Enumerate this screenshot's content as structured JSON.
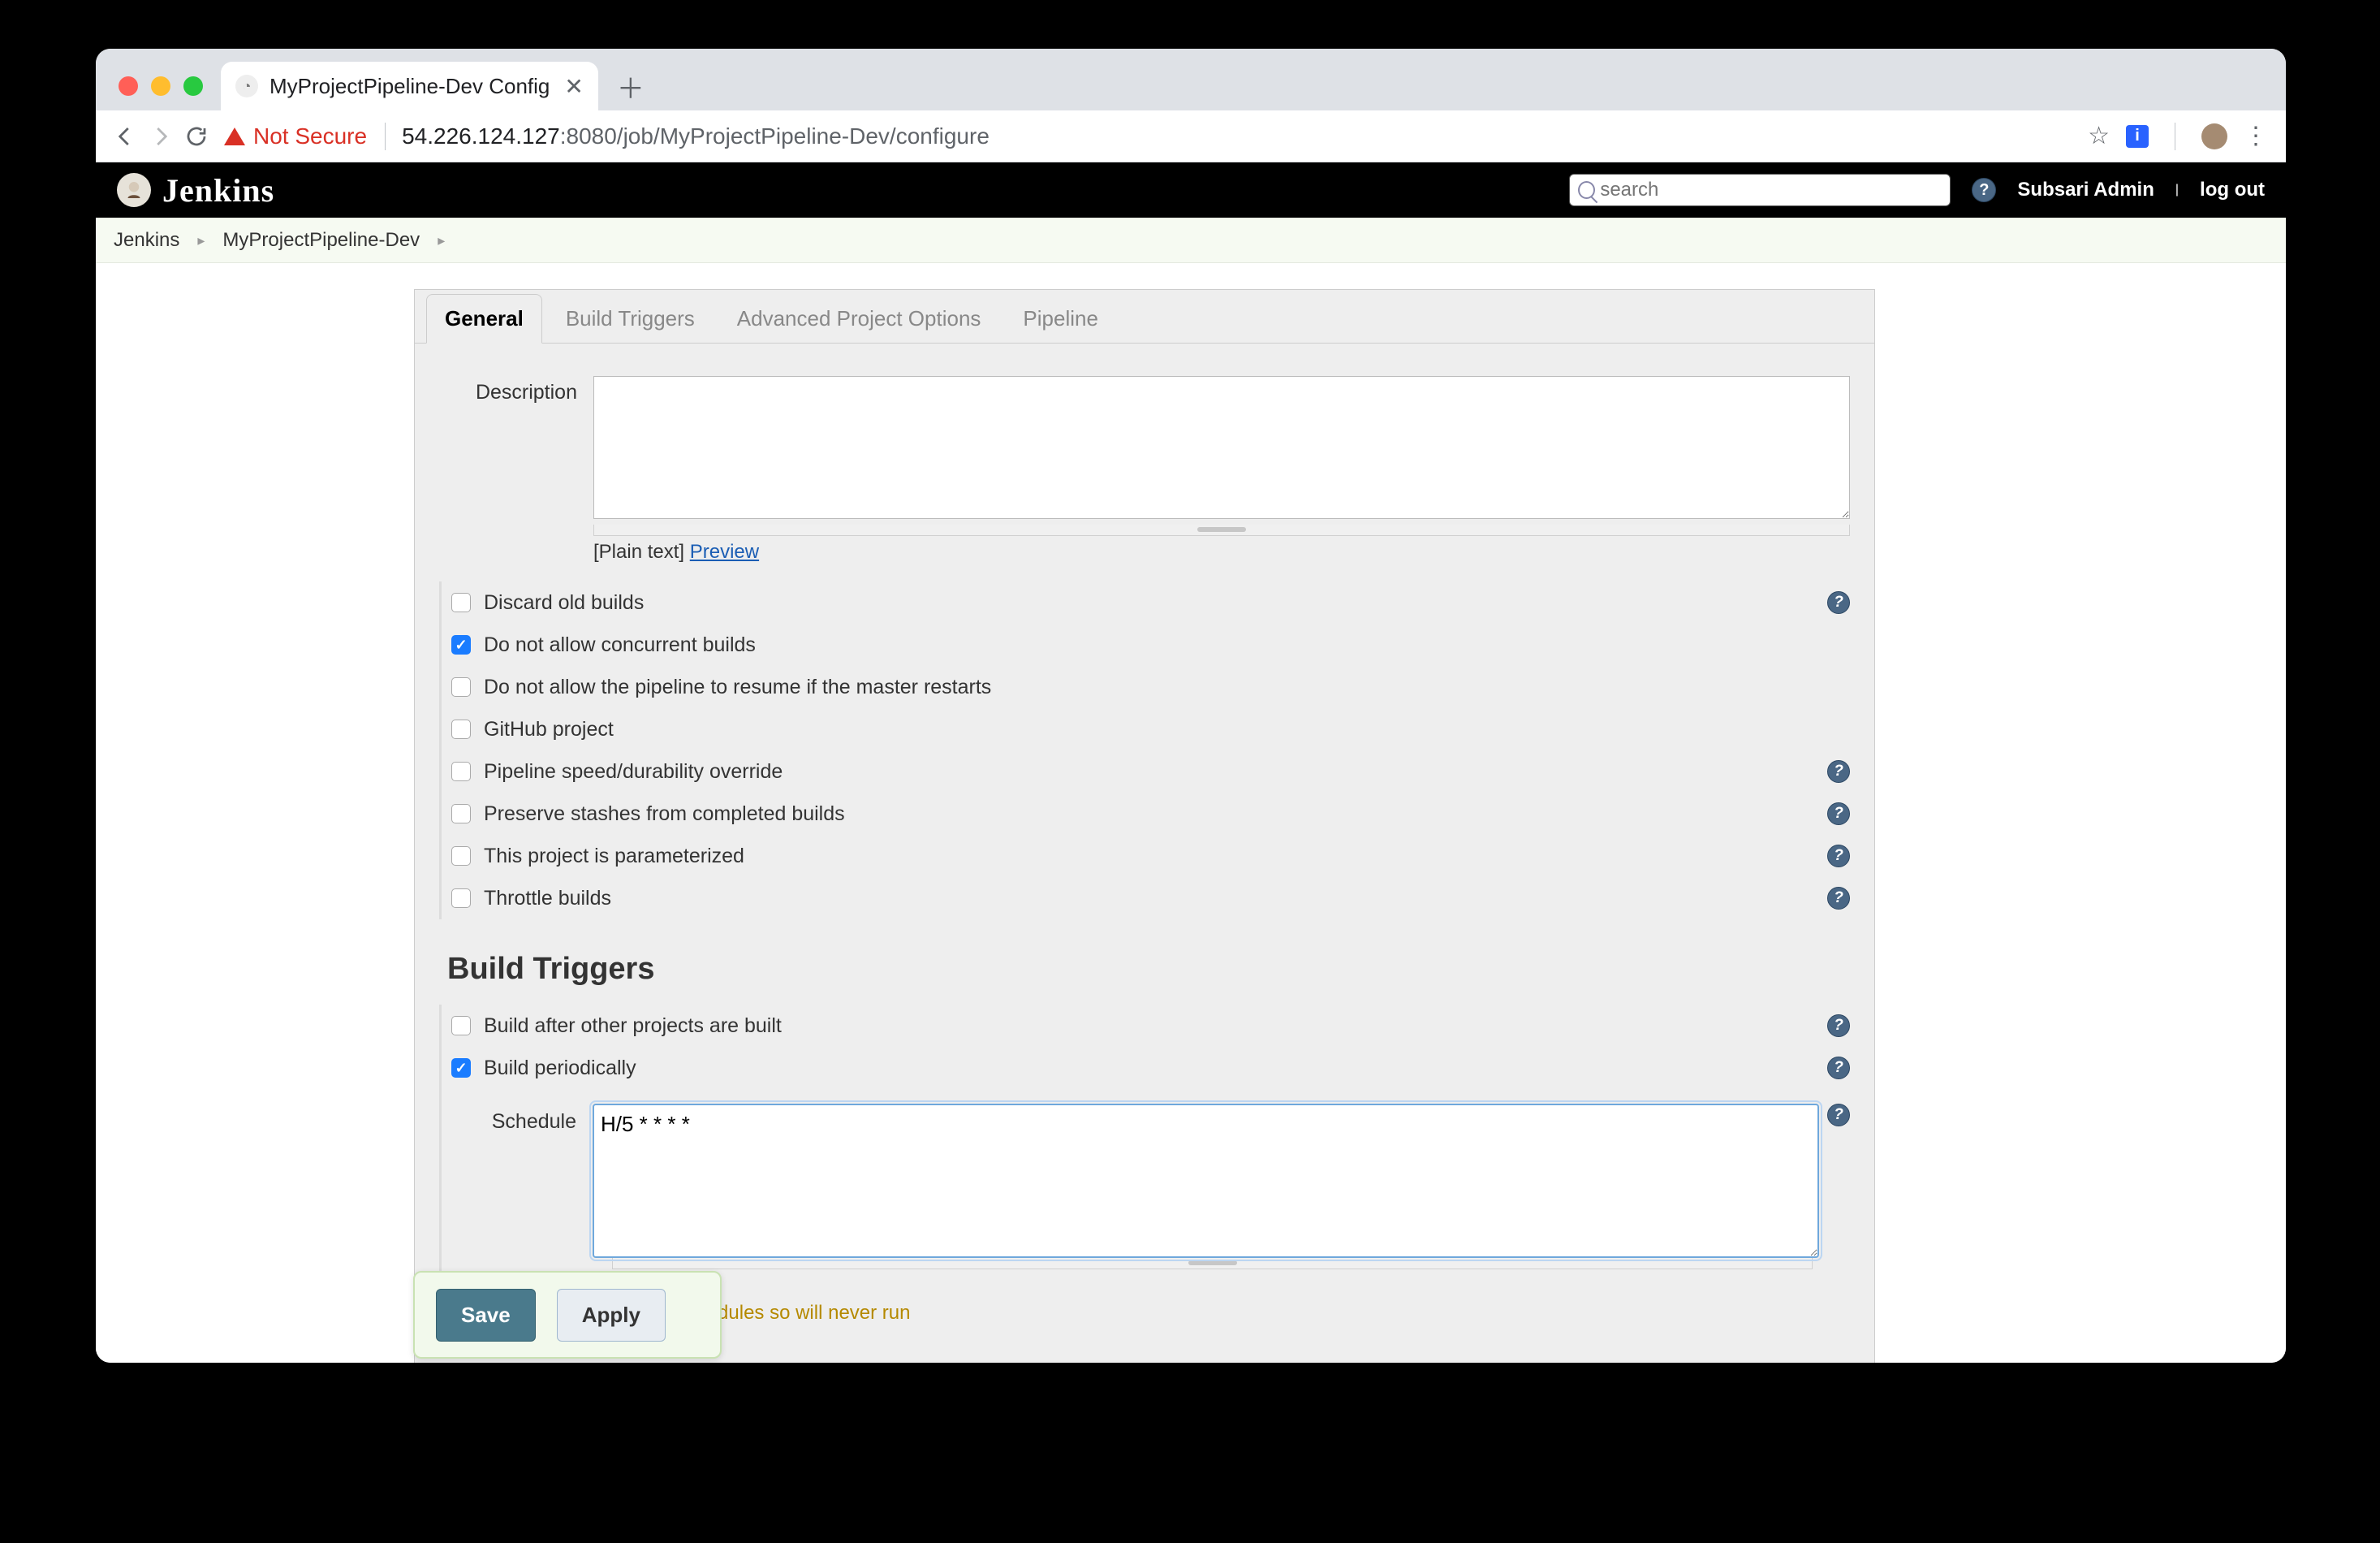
{
  "browser": {
    "tab_title": "MyProjectPipeline-Dev Config",
    "not_secure": "Not Secure",
    "url_host": "54.226.124.127",
    "url_port_path": ":8080/job/MyProjectPipeline-Dev/configure"
  },
  "jenkins": {
    "brand": "Jenkins",
    "search_placeholder": "search",
    "user": "Subsari Admin",
    "logout": "log out"
  },
  "breadcrumb": {
    "root": "Jenkins",
    "project": "MyProjectPipeline-Dev"
  },
  "tabs": {
    "general": "General",
    "build_triggers": "Build Triggers",
    "advanced": "Advanced Project Options",
    "pipeline": "Pipeline"
  },
  "form": {
    "description_label": "Description",
    "plaintext": "[Plain text]",
    "preview": "Preview",
    "options": {
      "discard": "Discard old builds",
      "no_concurrent": "Do not allow concurrent builds",
      "no_resume": "Do not allow the pipeline to resume if the master restarts",
      "github": "GitHub project",
      "durability": "Pipeline speed/durability override",
      "stashes": "Preserve stashes from completed builds",
      "parameterized": "This project is parameterized",
      "throttle": "Throttle builds"
    },
    "section_build_triggers": "Build Triggers",
    "triggers": {
      "build_after": "Build after other projects are built",
      "periodically": "Build periodically"
    },
    "schedule_label": "Schedule",
    "schedule_value": "H/5 * * * *",
    "warn": "No schedules so will never run",
    "save": "Save",
    "apply": "Apply"
  }
}
